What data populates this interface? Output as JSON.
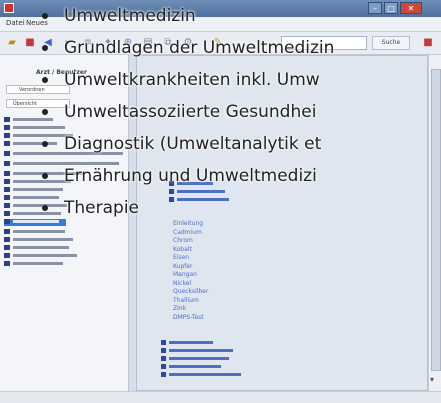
{
  "list": {
    "items": [
      "Umweltmedizin",
      "Grundlagen der Umweltmedizin",
      "Umweltkrankheiten inkl. Umw",
      "Umweltassoziierte Gesundhei",
      "Diagnostik (Umweltanalytik et",
      "Ernährung und Umweltmedizi",
      "Therapie"
    ]
  },
  "window": {
    "menu": [
      "Datei",
      "Neues"
    ]
  },
  "toolbar": {
    "search_label": "Suche"
  },
  "left_panel": {
    "header": "Arzt / Benutzer",
    "buttons": [
      "Verordnen",
      "Übersicht"
    ]
  },
  "tree": {
    "item_labels": [
      "Einleitung",
      "Cadmium",
      "Chrom",
      "Kobalt",
      "Eisen",
      "Kupfer",
      "Mangan",
      "Nickel",
      "Quecksilber",
      "Thallium",
      "Zink",
      "DMPS-Test"
    ]
  },
  "colors": {
    "titlebar": "#5b7fae",
    "selection": "#3a78e0",
    "tree_link": "#4d6fc4"
  }
}
